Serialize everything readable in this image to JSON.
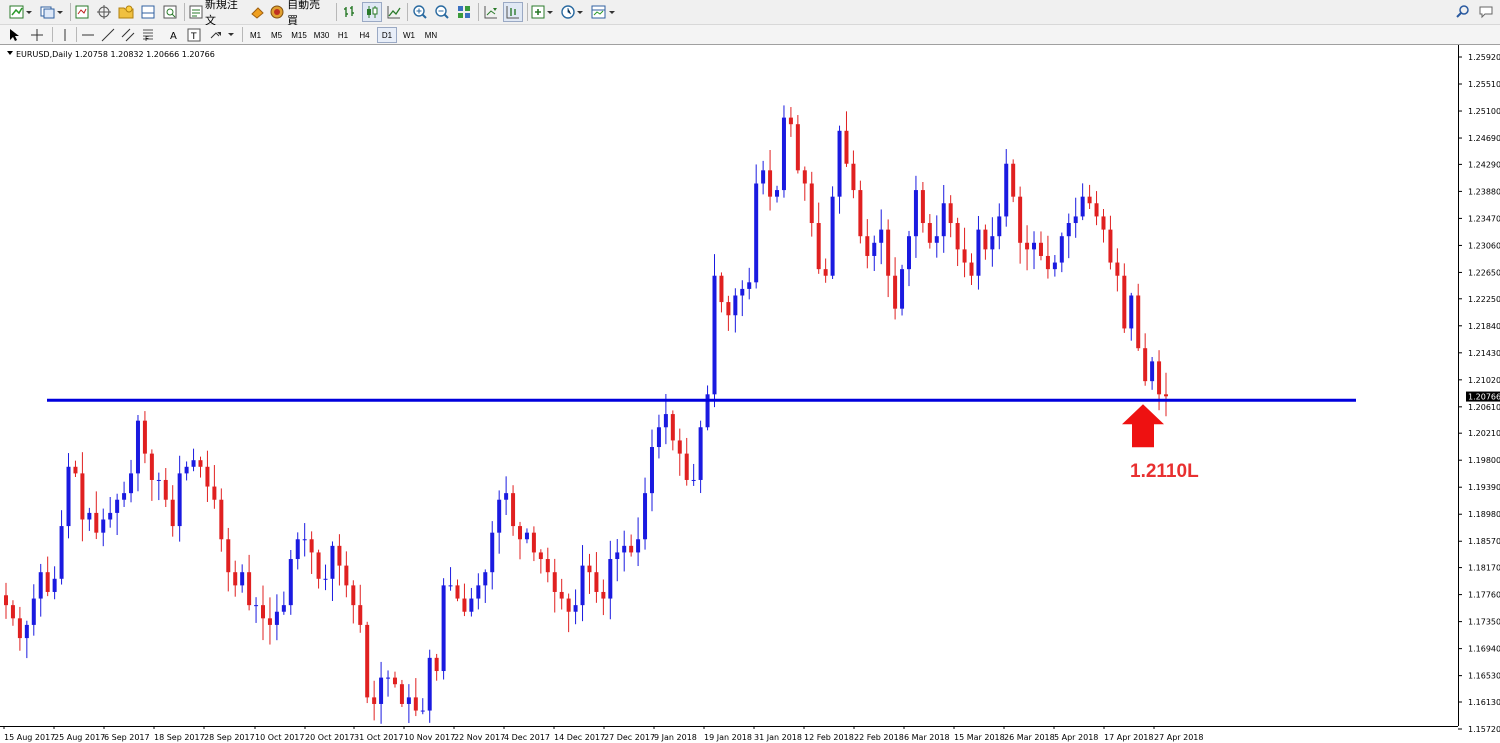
{
  "toolbar": {
    "new_order_label": "新規注文",
    "auto_trade_label": "自動売買"
  },
  "timeframes": [
    "M1",
    "M5",
    "M15",
    "M30",
    "H1",
    "H4",
    "D1",
    "W1",
    "MN"
  ],
  "active_timeframe": "D1",
  "chart_header": "EURUSD,Daily  1.20758 1.20832 1.20666 1.20766",
  "colors": {
    "bull": "#1a1ae0",
    "bear": "#e02020",
    "line": "#0000dd",
    "arrow": "#ee1111",
    "annotation": "#e83030"
  },
  "chart_data": {
    "type": "candlestick",
    "symbol": "EURUSD",
    "timeframe": "Daily",
    "ohlc_header": [
      1.20758,
      1.20832,
      1.20666,
      1.20766
    ],
    "price_ticks": [
      "1.25920",
      "1.25510",
      "1.25100",
      "1.24690",
      "1.24290",
      "1.23880",
      "1.23470",
      "1.23060",
      "1.22650",
      "1.22250",
      "1.21840",
      "1.21430",
      "1.21020",
      "1.20610",
      "1.20210",
      "1.19800",
      "1.19390",
      "1.18980",
      "1.18570",
      "1.18170",
      "1.17760",
      "1.17350",
      "1.16940",
      "1.16530",
      "1.16130",
      "1.15720"
    ],
    "current_price": "1.20766",
    "date_ticks": [
      "15 Aug 2017",
      "25 Aug 2017",
      "6 Sep 2017",
      "18 Sep 2017",
      "28 Sep 2017",
      "10 Oct 2017",
      "20 Oct 2017",
      "31 Oct 2017",
      "10 Nov 2017",
      "22 Nov 2017",
      "4 Dec 2017",
      "14 Dec 2017",
      "27 Dec 2017",
      "9 Jan 2018",
      "19 Jan 2018",
      "31 Jan 2018",
      "12 Feb 2018",
      "22 Feb 2018",
      "6 Mar 2018",
      "15 Mar 2018",
      "26 Mar 2018",
      "5 Apr 2018",
      "17 Apr 2018",
      "27 Apr 2018"
    ],
    "horizontal_line": 1.2071,
    "annotation": "1.2110L",
    "closes": [
      1.176,
      1.174,
      1.171,
      1.173,
      1.177,
      1.181,
      1.178,
      1.18,
      1.188,
      1.197,
      1.196,
      1.189,
      1.19,
      1.187,
      1.189,
      1.19,
      1.192,
      1.193,
      1.196,
      1.204,
      1.199,
      1.195,
      1.195,
      1.192,
      1.188,
      1.196,
      1.197,
      1.198,
      1.197,
      1.194,
      1.192,
      1.186,
      1.181,
      1.179,
      1.181,
      1.176,
      1.176,
      1.174,
      1.173,
      1.175,
      1.176,
      1.183,
      1.186,
      1.186,
      1.184,
      1.18,
      1.18,
      1.185,
      1.182,
      1.179,
      1.176,
      1.173,
      1.162,
      1.161,
      1.165,
      1.165,
      1.164,
      1.161,
      1.162,
      1.16,
      1.16,
      1.168,
      1.166,
      1.179,
      1.179,
      1.177,
      1.175,
      1.177,
      1.179,
      1.181,
      1.187,
      1.192,
      1.193,
      1.188,
      1.186,
      1.187,
      1.184,
      1.183,
      1.181,
      1.178,
      1.177,
      1.175,
      1.176,
      1.182,
      1.181,
      1.178,
      1.177,
      1.183,
      1.184,
      1.185,
      1.184,
      1.186,
      1.193,
      1.2,
      1.203,
      1.205,
      1.201,
      1.199,
      1.195,
      1.195,
      1.203,
      1.208,
      1.226,
      1.222,
      1.22,
      1.223,
      1.224,
      1.225,
      1.24,
      1.242,
      1.238,
      1.239,
      1.25,
      1.249,
      1.242,
      1.24,
      1.234,
      1.227,
      1.226,
      1.238,
      1.248,
      1.243,
      1.239,
      1.232,
      1.229,
      1.231,
      1.233,
      1.226,
      1.221,
      1.227,
      1.232,
      1.239,
      1.234,
      1.231,
      1.232,
      1.237,
      1.234,
      1.23,
      1.228,
      1.226,
      1.233,
      1.23,
      1.232,
      1.235,
      1.243,
      1.238,
      1.231,
      1.23,
      1.231,
      1.229,
      1.227,
      1.228,
      1.232,
      1.234,
      1.235,
      1.238,
      1.237,
      1.235,
      1.233,
      1.228,
      1.226,
      1.218,
      1.223,
      1.215,
      1.21,
      1.213,
      1.208,
      1.2077
    ]
  }
}
